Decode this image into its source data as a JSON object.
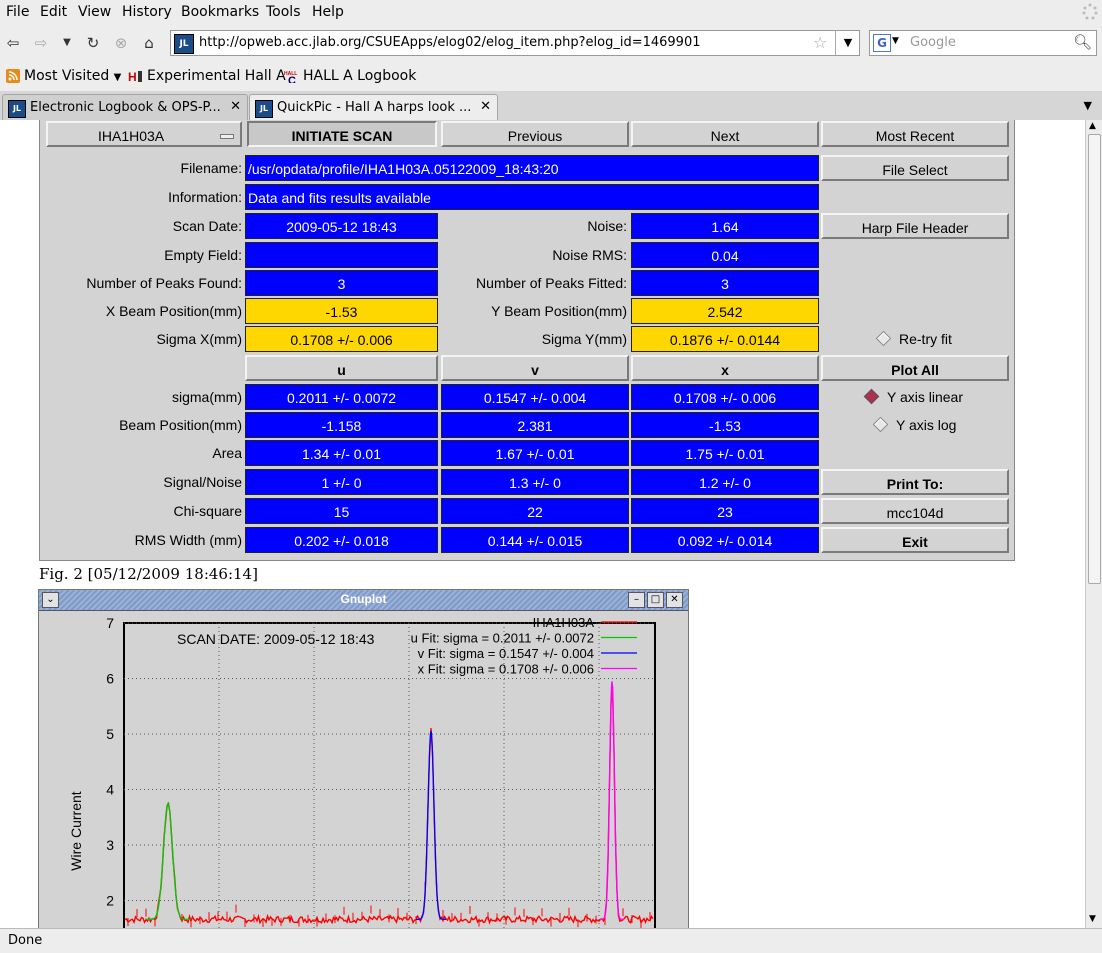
{
  "menu": [
    {
      "label": "File",
      "key": "F"
    },
    {
      "label": "Edit",
      "key": "E"
    },
    {
      "label": "View",
      "key": "V"
    },
    {
      "label": "History",
      "key": "s"
    },
    {
      "label": "Bookmarks",
      "key": "B"
    },
    {
      "label": "Tools",
      "key": "T"
    },
    {
      "label": "Help",
      "key": "H"
    }
  ],
  "nav": {
    "url": "http://opweb.acc.jlab.org/CSUEApps/elog02/elog_item.php?elog_id=1469901",
    "search_placeholder": "Google",
    "site_icon_text": "JL"
  },
  "bookmarks": {
    "most_visited": "Most Visited",
    "experimental": "Experimental Hall A",
    "logbook": "HALL A Logbook"
  },
  "tabs": [
    {
      "label": "Electronic Logbook & OPS-P...",
      "active": false
    },
    {
      "label": "QuickPic - Hall A harps look ...",
      "active": true
    }
  ],
  "status": "Done",
  "harp": {
    "selector": "IHA1H03A",
    "buttons": {
      "initiate": "INITIATE SCAN",
      "previous": "Previous",
      "next": "Next",
      "most_recent": "Most Recent",
      "file_select": "File Select",
      "harp_header": "Harp File Header",
      "plot_all": "Plot All",
      "print_to": "Print To:",
      "printer": "mcc104d",
      "exit": "Exit"
    },
    "filename_label": "Filename:",
    "filename": "/usr/opdata/profile/IHA1H03A.05122009_18:43:20",
    "information_label": "Information:",
    "information": "Data and fits results available",
    "scan_date_label": "Scan Date:",
    "scan_date": "2009-05-12   18:43",
    "noise_label": "Noise:",
    "noise": "1.64",
    "empty_field_label": "Empty Field:",
    "empty_field": "",
    "noise_rms_label": "Noise RMS:",
    "noise_rms": "0.04",
    "peaks_found_label": "Number of Peaks Found:",
    "peaks_found": "3",
    "peaks_fitted_label": "Number of Peaks Fitted:",
    "peaks_fitted": "3",
    "x_beam_label": "X Beam Position(mm)",
    "x_beam": "-1.53",
    "y_beam_label": "Y Beam Position(mm)",
    "y_beam": "2.542",
    "sigma_x_label": "Sigma X(mm)",
    "sigma_x": "0.1708 +/- 0.006",
    "sigma_y_label": "Sigma Y(mm)",
    "sigma_y": "0.1876 +/- 0.0144",
    "retry_fit": "Re-try fit",
    "y_axis_linear": "Y axis linear",
    "y_axis_log": "Y axis log",
    "columns": [
      "u",
      "v",
      "x"
    ],
    "rows": [
      {
        "label": "sigma(mm)",
        "values": [
          "0.2011 +/- 0.0072",
          "0.1547 +/- 0.004",
          "0.1708 +/- 0.006"
        ]
      },
      {
        "label": "Beam Position(mm)",
        "values": [
          "-1.158",
          "2.381",
          "-1.53"
        ]
      },
      {
        "label": "Area",
        "values": [
          "1.34 +/- 0.01",
          "1.67 +/- 0.01",
          "1.75 +/- 0.01"
        ]
      },
      {
        "label": "Signal/Noise",
        "values": [
          "1 +/- 0",
          "1.3 +/- 0",
          "1.2 +/- 0"
        ]
      },
      {
        "label": "Chi-square",
        "values": [
          "15",
          "22",
          "23"
        ]
      },
      {
        "label": "RMS Width (mm)",
        "values": [
          "0.202 +/- 0.018",
          "0.144 +/- 0.015",
          "0.092 +/- 0.014"
        ]
      }
    ]
  },
  "figure_caption": "Fig. 2 [05/12/2009 18:46:14]",
  "gnuplot": {
    "title": "Gnuplot",
    "scan_date": "SCAN DATE: 2009-05-12   18:43",
    "ylabel": "Wire Current",
    "yticks": [
      "7",
      "6",
      "5",
      "4",
      "3",
      "2"
    ],
    "legend": [
      {
        "key": "",
        "label": "IHA1H03A",
        "color": "#ff0000"
      },
      {
        "key": "u",
        "label": "Fit: sigma = 0.2011 +/- 0.0072",
        "color": "#00cc00"
      },
      {
        "key": "v",
        "label": "Fit: sigma = 0.1547 +/- 0.004",
        "color": "#0000ff"
      },
      {
        "key": "x",
        "label": "Fit: sigma = 0.1708 +/- 0.006",
        "color": "#ff00ff"
      }
    ]
  }
}
